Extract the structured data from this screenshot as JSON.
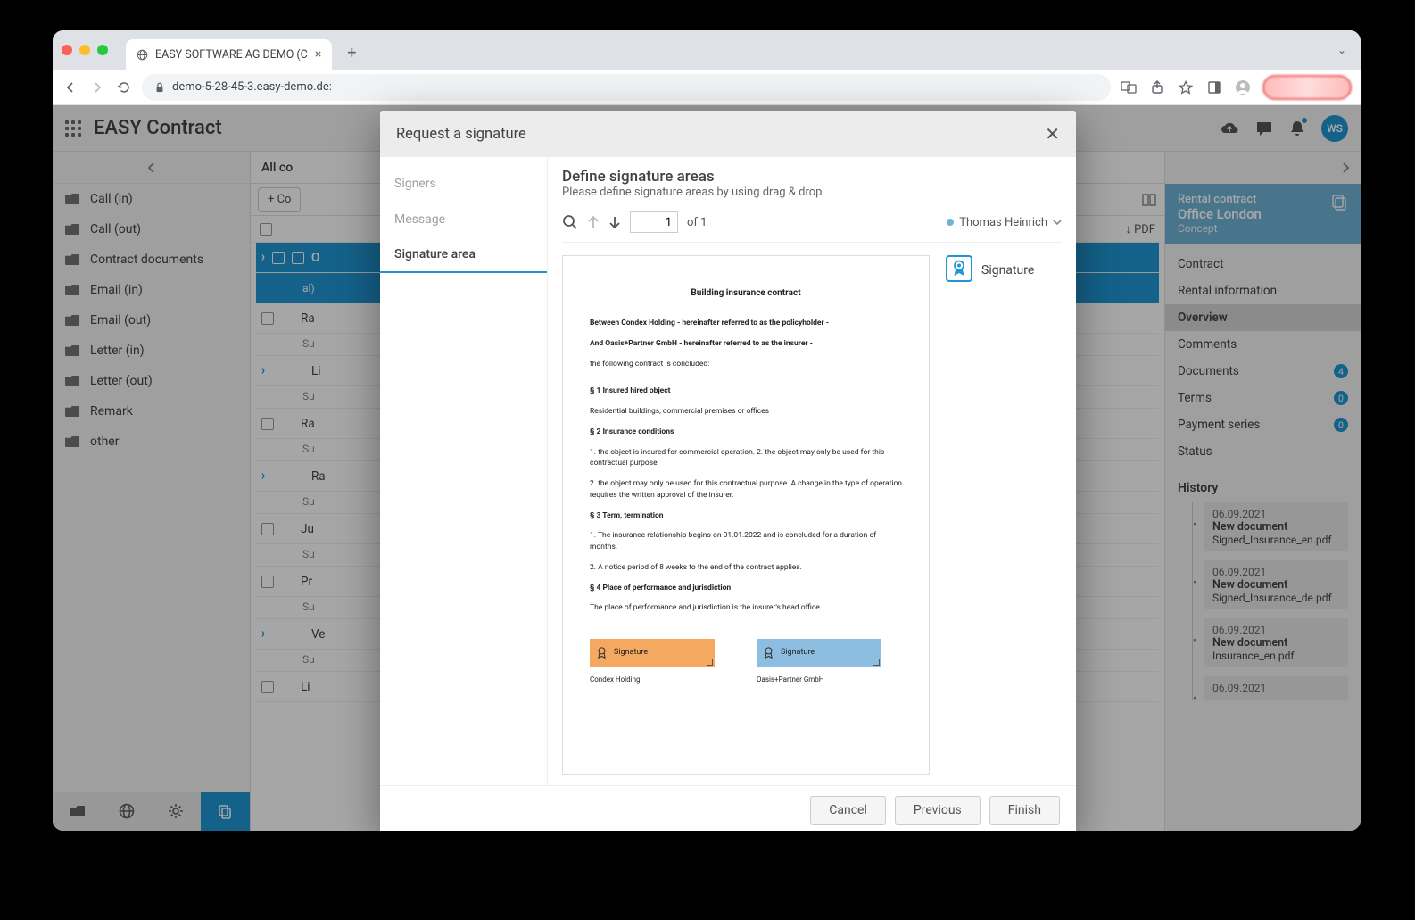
{
  "browser": {
    "tab_title": "EASY SOFTWARE AG DEMO (C",
    "url": "demo-5-28-45-3.easy-demo.de:"
  },
  "app": {
    "title": "EASY Contract",
    "avatar": "WS"
  },
  "sidebar": {
    "items": [
      {
        "label": "Call (in)"
      },
      {
        "label": "Call (out)"
      },
      {
        "label": "Contract documents"
      },
      {
        "label": "Email (in)"
      },
      {
        "label": "Email (out)"
      },
      {
        "label": "Letter (in)"
      },
      {
        "label": "Letter (out)"
      },
      {
        "label": "Remark"
      },
      {
        "label": "other"
      }
    ]
  },
  "center": {
    "header": "All co",
    "create_btn": "+ Co",
    "pdf_label": "↓ PDF",
    "rows": [
      {
        "label": "O",
        "sel": true,
        "sub": ""
      },
      {
        "label": "Ra",
        "sub": "Su"
      },
      {
        "label": "Li",
        "sub": "Su"
      },
      {
        "label": "Ra",
        "sub": "Su"
      },
      {
        "label": "Ra",
        "sub": "Su"
      },
      {
        "label": "Ju",
        "sub": "Su"
      },
      {
        "label": "Pr",
        "sub": "Su"
      },
      {
        "label": "Ve",
        "sub": "Su"
      },
      {
        "label": "Li",
        "sub": ""
      }
    ]
  },
  "rpanel": {
    "card": {
      "line1": "Rental contract",
      "line2": "Office London",
      "line3": "Concept"
    },
    "nav": [
      {
        "label": "Contract"
      },
      {
        "label": "Rental information"
      },
      {
        "label": "Overview",
        "active": true
      },
      {
        "label": "Comments"
      },
      {
        "label": "Documents",
        "count": "4"
      },
      {
        "label": "Terms",
        "count": "0"
      },
      {
        "label": "Payment series",
        "count": "0"
      },
      {
        "label": "Status"
      }
    ],
    "history_title": "History",
    "history": [
      {
        "date": "06.09.2021",
        "title": "New document",
        "file": "Signed_Insurance_en.pdf"
      },
      {
        "date": "06.09.2021",
        "title": "New document",
        "file": "Signed_Insurance_de.pdf"
      },
      {
        "date": "06.09.2021",
        "title": "New document",
        "file": "Insurance_en.pdf"
      },
      {
        "date": "06.09.2021",
        "title": "",
        "file": ""
      }
    ]
  },
  "modal": {
    "title": "Request a signature",
    "steps": [
      {
        "label": "Signers"
      },
      {
        "label": "Message"
      },
      {
        "label": "Signature area",
        "active": true
      }
    ],
    "heading": "Define signature areas",
    "sub": "Please define signature areas by using drag & drop",
    "page_num": "1",
    "page_of": "of 1",
    "signer": "Thomas Heinrich",
    "palette_label": "Signature",
    "footer": {
      "cancel": "Cancel",
      "prev": "Previous",
      "finish": "Finish"
    },
    "doc": {
      "title": "Building insurance contract",
      "l1": "Between Condex Holding - hereinafter referred to as the policyholder -",
      "l2": "And Oasis+Partner GmbH - hereinafter referred to as the insurer -",
      "l3": "the following contract is concluded:",
      "s1": "§ 1 Insured hired object",
      "s1a": "Residential buildings, commercial premises or offices",
      "s2": "§ 2 Insurance conditions",
      "s2a": "1. the object is insured for commercial operation. 2. the object may only be used for this contractual purpose.",
      "s2b": "2. the object may only be used for this contractual purpose. A change in the type of operation requires the written approval of the insurer.",
      "s3": "§ 3 Term, termination",
      "s3a": "1. The insurance relationship begins on 01.01.2022 and is concluded for a duration of  months.",
      "s3b": "2. A notice period of 8 weeks to the end of the contract applies.",
      "s4": "§ 4 Place of performance and jurisdiction",
      "s4a": "The place of performance and jurisdiction is the insurer's head office.",
      "sig_a": "Signature",
      "sig_b": "Signature",
      "party_a": "Condex Holding",
      "party_b": "Oasis+Partner GmbH"
    }
  }
}
